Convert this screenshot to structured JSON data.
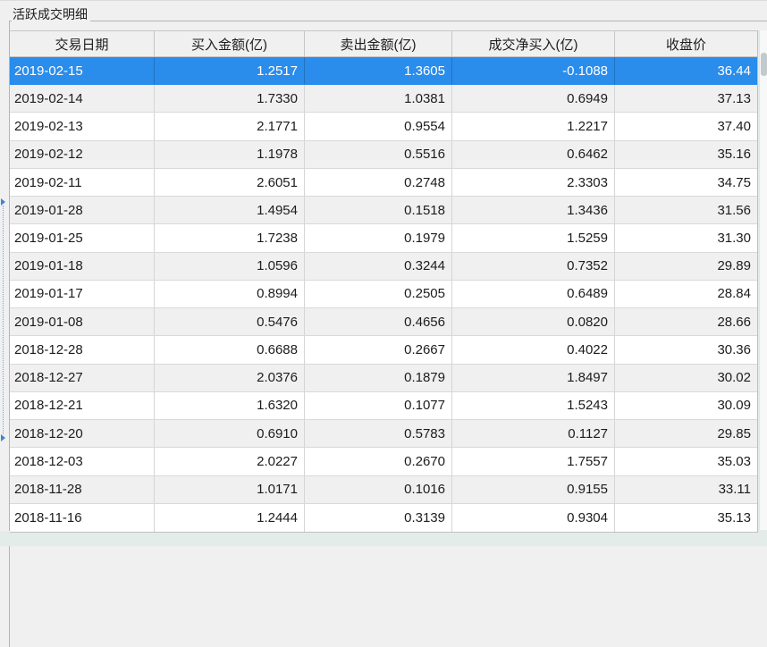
{
  "panel": {
    "title": "活跃成交明细"
  },
  "table": {
    "columns": [
      {
        "label": "交易日期",
        "align": "left"
      },
      {
        "label": "买入金额(亿)",
        "align": "right"
      },
      {
        "label": "卖出金额(亿)",
        "align": "right"
      },
      {
        "label": "成交净买入(亿)",
        "align": "right"
      },
      {
        "label": "收盘价",
        "align": "right"
      }
    ],
    "selected_row_index": 0,
    "rows": [
      [
        "2019-02-15",
        "1.2517",
        "1.3605",
        "-0.1088",
        "36.44"
      ],
      [
        "2019-02-14",
        "1.7330",
        "1.0381",
        "0.6949",
        "37.13"
      ],
      [
        "2019-02-13",
        "2.1771",
        "0.9554",
        "1.2217",
        "37.40"
      ],
      [
        "2019-02-12",
        "1.1978",
        "0.5516",
        "0.6462",
        "35.16"
      ],
      [
        "2019-02-11",
        "2.6051",
        "0.2748",
        "2.3303",
        "34.75"
      ],
      [
        "2019-01-28",
        "1.4954",
        "0.1518",
        "1.3436",
        "31.56"
      ],
      [
        "2019-01-25",
        "1.7238",
        "0.1979",
        "1.5259",
        "31.30"
      ],
      [
        "2019-01-18",
        "1.0596",
        "0.3244",
        "0.7352",
        "29.89"
      ],
      [
        "2019-01-17",
        "0.8994",
        "0.2505",
        "0.6489",
        "28.84"
      ],
      [
        "2019-01-08",
        "0.5476",
        "0.4656",
        "0.0820",
        "28.66"
      ],
      [
        "2018-12-28",
        "0.6688",
        "0.2667",
        "0.4022",
        "30.36"
      ],
      [
        "2018-12-27",
        "2.0376",
        "0.1879",
        "1.8497",
        "30.02"
      ],
      [
        "2018-12-21",
        "1.6320",
        "0.1077",
        "1.5243",
        "30.09"
      ],
      [
        "2018-12-20",
        "0.6910",
        "0.5783",
        "0.1127",
        "29.85"
      ],
      [
        "2018-12-03",
        "2.0227",
        "0.2670",
        "1.7557",
        "35.03"
      ],
      [
        "2018-11-28",
        "1.0171",
        "0.1016",
        "0.9155",
        "33.11"
      ],
      [
        "2018-11-16",
        "1.2444",
        "0.3139",
        "0.9304",
        "35.13"
      ]
    ]
  },
  "colors": {
    "background": "#f0f0f0",
    "header_bg": "#f0f0f0",
    "row": "#ffffff",
    "row_alt": "#f0f0f0",
    "grid": "#d9d9d9",
    "border": "#b4b4b4",
    "text": "#1c1c1c",
    "selection": "#2a8ceb",
    "selection_text": "#ffffff",
    "teal": "#e3ece9",
    "scroll_thumb": "#c3cacd",
    "splitter": "#3f83d6"
  }
}
